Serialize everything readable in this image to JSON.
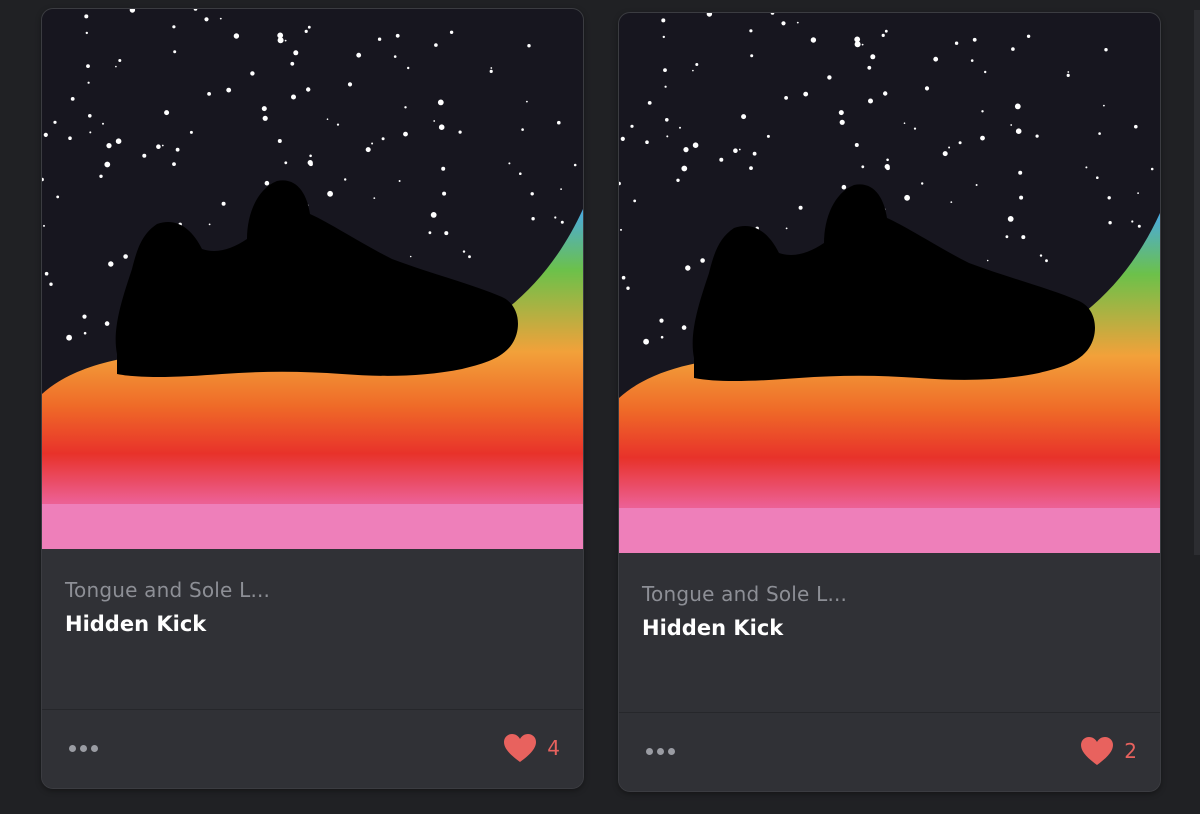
{
  "cards": [
    {
      "collection": "Tongue and Sole L...",
      "name": "Hidden Kick",
      "likes": "4",
      "image_icon": "sneaker-silhouette-on-rainbow-planet"
    },
    {
      "collection": "Tongue and Sole L...",
      "name": "Hidden Kick",
      "likes": "2",
      "image_icon": "sneaker-silhouette-on-rainbow-planet"
    }
  ],
  "colors": {
    "page_background": "#202124",
    "card_background": "#303136",
    "like_color": "#e8625e",
    "space": "#15141f",
    "rainbow": [
      "#4aa8e0",
      "#6fc04a",
      "#f2a23a",
      "#f07a2a",
      "#e8332a",
      "#ec5a8c",
      "#ee7bb7"
    ]
  },
  "icons": {
    "more": "more-dots-icon",
    "like": "heart-icon"
  }
}
